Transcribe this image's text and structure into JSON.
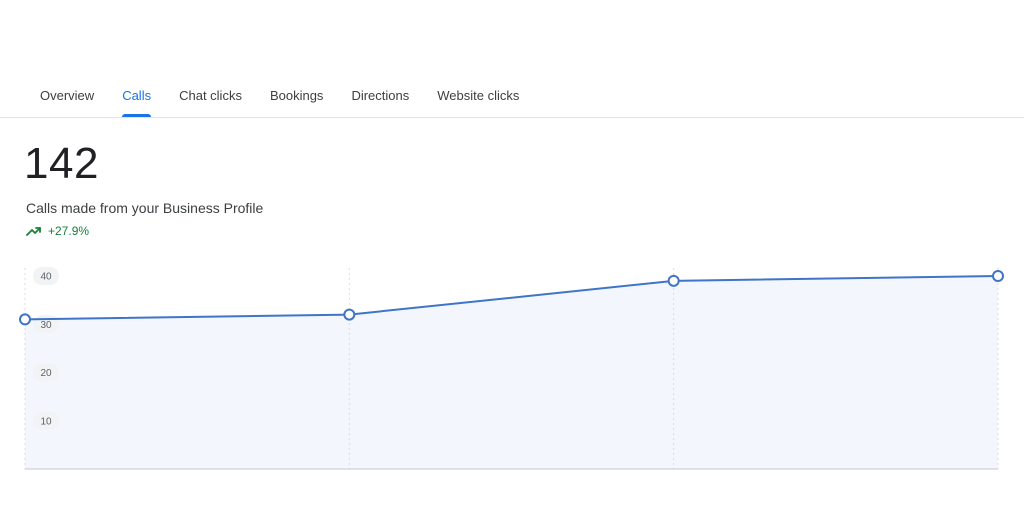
{
  "tabs": [
    {
      "label": "Overview",
      "active": false
    },
    {
      "label": "Calls",
      "active": true
    },
    {
      "label": "Chat clicks",
      "active": false
    },
    {
      "label": "Bookings",
      "active": false
    },
    {
      "label": "Directions",
      "active": false
    },
    {
      "label": "Website clicks",
      "active": false
    }
  ],
  "metric": {
    "value": "142",
    "label": "Calls made from your Business Profile",
    "change": "+27.9%",
    "change_icon": "trending-up-icon"
  },
  "colors": {
    "accent": "#1a73e8",
    "line": "#3f74c9",
    "area": "#f3f7fd",
    "positive": "#188038"
  },
  "chart_data": {
    "type": "area",
    "yticks": [
      10,
      20,
      30,
      40
    ],
    "ylim": [
      0,
      40
    ],
    "series": [
      {
        "values": [
          31,
          32,
          39,
          40
        ]
      }
    ],
    "x_points": 4,
    "grid": "vertical dashed lines at data points",
    "legend": "none"
  }
}
